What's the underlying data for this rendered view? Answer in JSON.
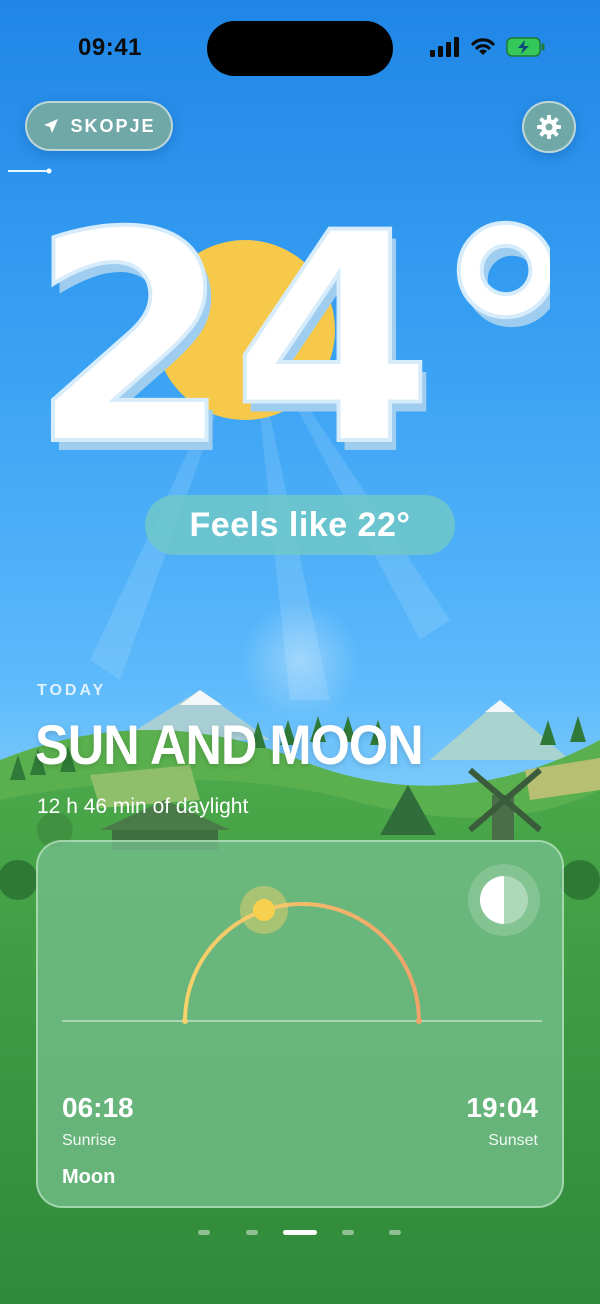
{
  "status_bar": {
    "time": "09:41"
  },
  "header": {
    "location": "SKOPJE"
  },
  "weather": {
    "temperature": "24°",
    "feels_like": "Feels like 22°"
  },
  "section": {
    "kicker": "TODAY",
    "title": "SUN AND MOON",
    "daylight": "12 h 46 min of daylight"
  },
  "sun_card": {
    "sunrise_time": "06:18",
    "sunrise_label": "Sunrise",
    "sunset_time": "19:04",
    "sunset_label": "Sunset",
    "moon_label": "Moon"
  },
  "pagination": {
    "count": 5,
    "active_index": 2
  },
  "colors": {
    "sky_top": "#1f86e6",
    "grass": "#3f9a44",
    "sun": "#f7c94a",
    "arc_start": "#f6d26a",
    "arc_end": "#f0a36a"
  },
  "icons": [
    "location-arrow-icon",
    "gear-icon",
    "cellular-signal-icon",
    "wifi-icon",
    "battery-charging-icon",
    "moon-phase-icon",
    "sun-icon"
  ]
}
